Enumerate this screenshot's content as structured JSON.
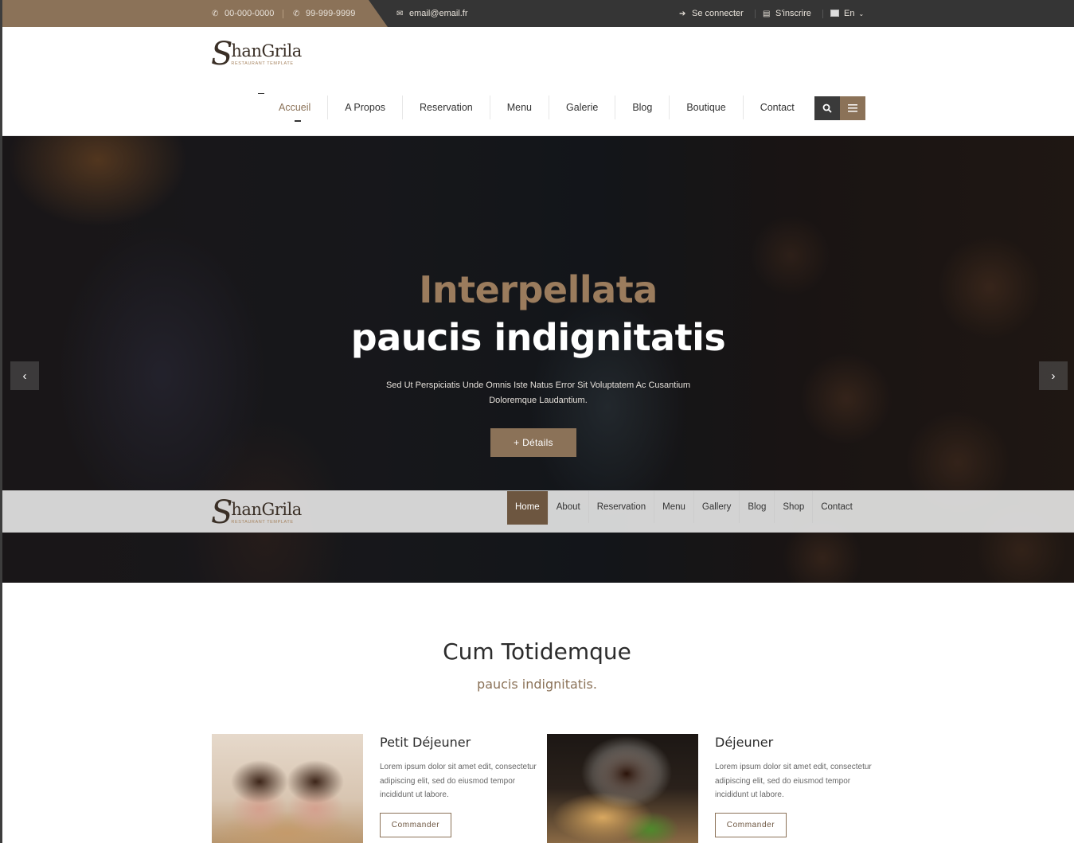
{
  "topbar": {
    "phone1": "00-000-0000",
    "phone2": "99-999-9999",
    "email": "email@email.fr",
    "login": "Se connecter",
    "register": "S'inscrire",
    "language": "En",
    "phone_icon": "phone-icon",
    "email_icon": "envelope-icon",
    "login_icon": "sign-in-icon",
    "register_icon": "document-icon"
  },
  "logo": {
    "initial": "S",
    "name": "hanGrila",
    "tagline": "RESTAURANT TEMPLATE"
  },
  "nav": {
    "items": [
      "Accueil",
      "A Propos",
      "Reservation",
      "Menu",
      "Galerie",
      "Blog",
      "Boutique",
      "Contact"
    ],
    "active_index": 0
  },
  "hero": {
    "title_line1": "Interpellata",
    "title_line2": "paucis indignitatis",
    "text": "Sed Ut Perspiciatis Unde Omnis Iste Natus Error Sit Voluptatem Ac Cusantium Doloremque Laudantium.",
    "button": "+ Détails",
    "prev": "‹",
    "next": "›"
  },
  "sticky_nav": {
    "items": [
      "Home",
      "About",
      "Reservation",
      "Menu",
      "Gallery",
      "Blog",
      "Shop",
      "Contact"
    ],
    "active_index": 0
  },
  "section": {
    "title": "Cum Totidemque",
    "subtitle": "paucis indignitatis."
  },
  "cards": [
    {
      "title": "Petit Déjeuner",
      "text": "Lorem ipsum dolor sit amet edit, consectetur adipiscing elit, sed do eiusmod tempor incididunt ut labore.",
      "button": "Commander",
      "image": "cupcakes"
    },
    {
      "title": "Déjeuner",
      "text": "Lorem ipsum dolor sit amet edit, consectetur adipiscing elit, sed do eiusmod tempor incididunt ut labore.",
      "button": "Commander",
      "image": "coffee and sandwich"
    }
  ],
  "colors": {
    "accent": "#8b7258",
    "dark": "#353535",
    "active_sticky": "#6d5640"
  }
}
